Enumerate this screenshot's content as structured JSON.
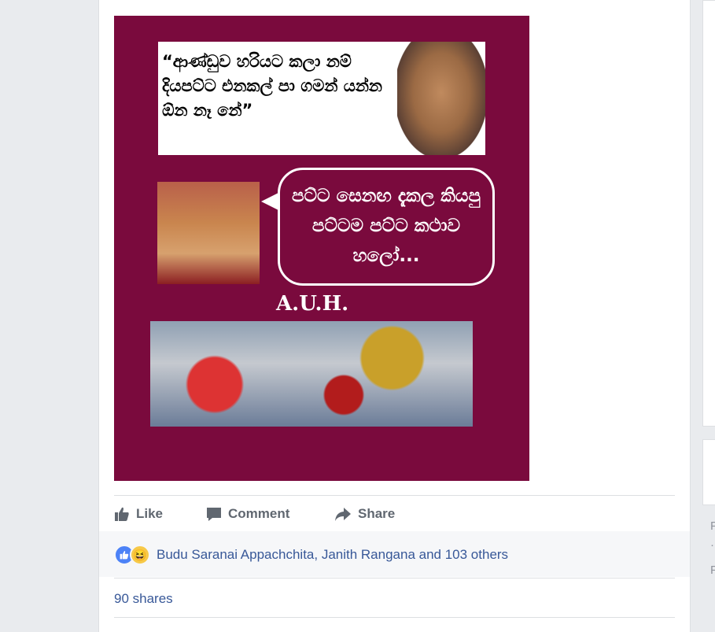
{
  "post": {
    "image": {
      "quote_text": "“ආණ්ඩුව හරියට කලා නම් දියපට්ට එනකල් පා ගමන් යන්න ඕන නෑ නේ”",
      "bubble_text": "පට්ට සෙනඟ දැකල කියපු පට්ටම පට්ට කථාව හලෝ...",
      "signature": "A.U.H."
    },
    "actions": {
      "like": "Like",
      "comment": "Comment",
      "share": "Share"
    },
    "reactions": {
      "names": "Budu Saranai Appachchita, Janith Rangana and 103 others",
      "icons": [
        "like-reaction-icon",
        "haha-reaction-icon"
      ]
    },
    "shares": "90 shares"
  },
  "colors": {
    "image_background": "#7a0a3d",
    "link": "#385898",
    "action_text": "#606770",
    "like_blue": "#4c82f7"
  }
}
